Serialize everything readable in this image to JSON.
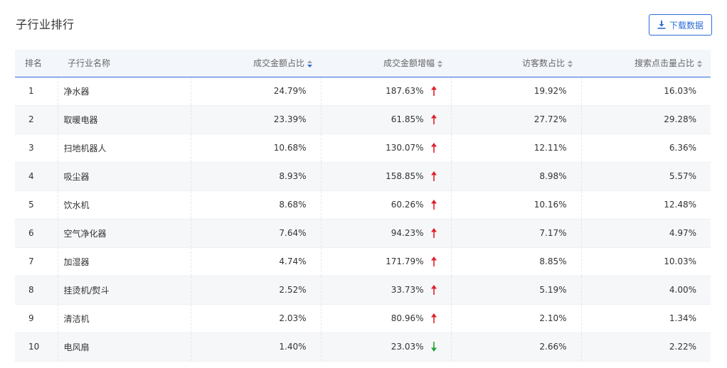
{
  "panel": {
    "title": "子行业排行",
    "download_label": "下载数据"
  },
  "colors": {
    "accent": "#2c6cd6",
    "up": "#e0202b",
    "down": "#20a53a"
  },
  "table": {
    "headers": {
      "rank": "排名",
      "name": "子行业名称",
      "amount_share": "成交金额占比",
      "amount_growth": "成交金额增幅",
      "visitor_share": "访客数占比",
      "search_share": "搜索点击量占比"
    },
    "rows": [
      {
        "rank": "1",
        "name": "净水器",
        "amount_share": "24.79%",
        "amount_growth": "187.63%",
        "trend": "up",
        "visitor_share": "19.92%",
        "search_share": "16.03%"
      },
      {
        "rank": "2",
        "name": "取暖电器",
        "amount_share": "23.39%",
        "amount_growth": "61.85%",
        "trend": "up",
        "visitor_share": "27.72%",
        "search_share": "29.28%"
      },
      {
        "rank": "3",
        "name": "扫地机器人",
        "amount_share": "10.68%",
        "amount_growth": "130.07%",
        "trend": "up",
        "visitor_share": "12.11%",
        "search_share": "6.36%"
      },
      {
        "rank": "4",
        "name": "吸尘器",
        "amount_share": "8.93%",
        "amount_growth": "158.85%",
        "trend": "up",
        "visitor_share": "8.98%",
        "search_share": "5.57%"
      },
      {
        "rank": "5",
        "name": "饮水机",
        "amount_share": "8.68%",
        "amount_growth": "60.26%",
        "trend": "up",
        "visitor_share": "10.16%",
        "search_share": "12.48%"
      },
      {
        "rank": "6",
        "name": "空气净化器",
        "amount_share": "7.64%",
        "amount_growth": "94.23%",
        "trend": "up",
        "visitor_share": "7.17%",
        "search_share": "4.97%"
      },
      {
        "rank": "7",
        "name": "加湿器",
        "amount_share": "4.74%",
        "amount_growth": "171.79%",
        "trend": "up",
        "visitor_share": "8.85%",
        "search_share": "10.03%"
      },
      {
        "rank": "8",
        "name": "挂烫机/熨斗",
        "amount_share": "2.52%",
        "amount_growth": "33.73%",
        "trend": "up",
        "visitor_share": "5.19%",
        "search_share": "4.00%"
      },
      {
        "rank": "9",
        "name": "清洁机",
        "amount_share": "2.03%",
        "amount_growth": "80.96%",
        "trend": "up",
        "visitor_share": "2.10%",
        "search_share": "1.34%"
      },
      {
        "rank": "10",
        "name": "电风扇",
        "amount_share": "1.40%",
        "amount_growth": "23.03%",
        "trend": "down",
        "visitor_share": "2.66%",
        "search_share": "2.22%"
      }
    ]
  }
}
